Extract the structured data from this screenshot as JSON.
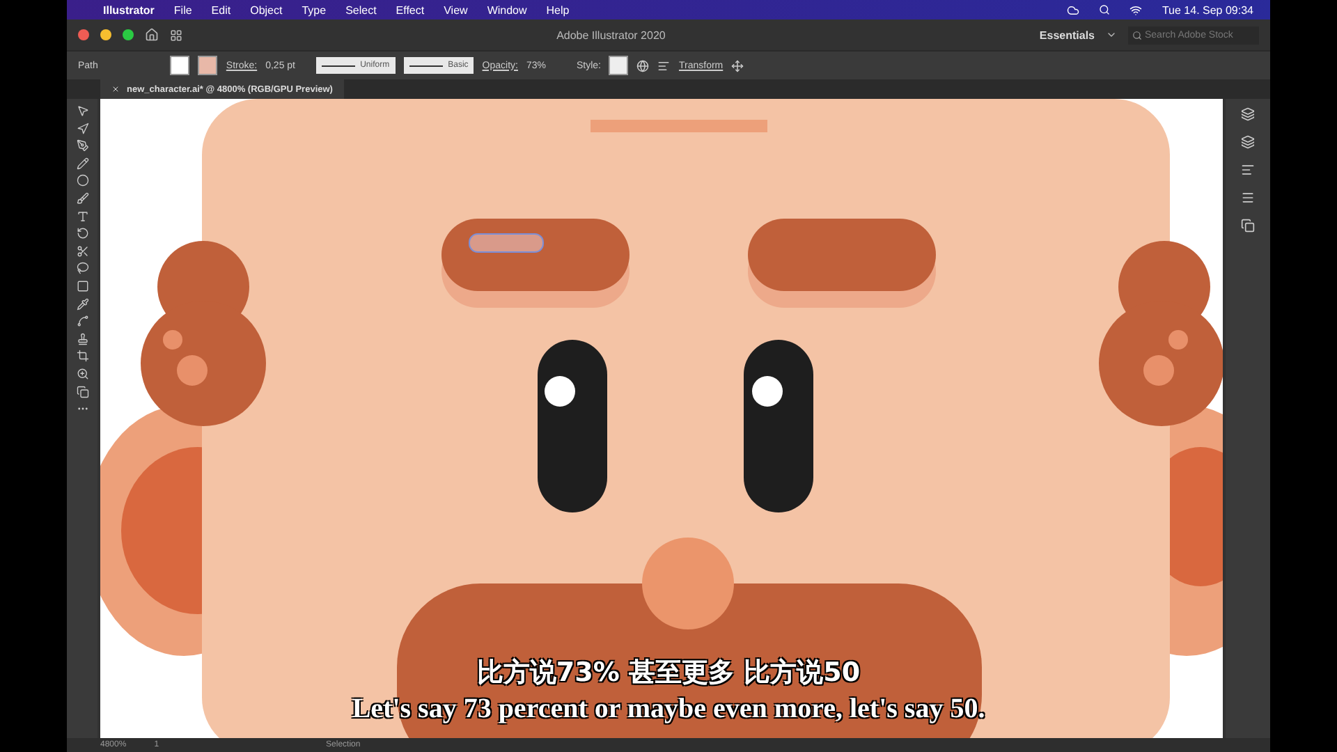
{
  "menubar": {
    "app": "Illustrator",
    "items": [
      "File",
      "Edit",
      "Object",
      "Type",
      "Select",
      "Effect",
      "View",
      "Window",
      "Help"
    ],
    "clock": "Tue 14. Sep 09:34"
  },
  "titlebar": {
    "title": "Adobe Illustrator 2020",
    "workspace": "Essentials",
    "search": {
      "placeholder": "Search Adobe Stock"
    }
  },
  "control_bar": {
    "selection": "Path",
    "stroke_label": "Stroke:",
    "stroke_weight": "0,25 pt",
    "profile": "Uniform",
    "brush": "Basic",
    "opacity_label": "Opacity:",
    "opacity": "73%",
    "style_label": "Style:",
    "transform": "Transform"
  },
  "document_tab": {
    "title": "new_character.ai* @ 4800% (RGB/GPU Preview)"
  },
  "status_bar": {
    "zoom": "4800%",
    "artboard": "1",
    "tool": "Selection"
  },
  "subtitles": {
    "chinese": "比方说73% 甚至更多 比方说50",
    "english": "Let's say 73 percent or maybe even more, let's say 50."
  }
}
